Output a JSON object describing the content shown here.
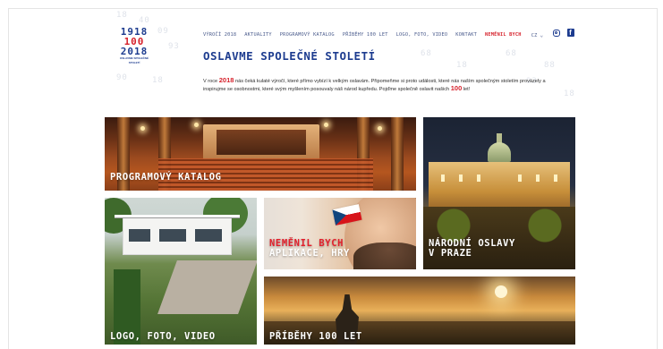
{
  "logo": {
    "years": [
      "1918",
      "100",
      "2018"
    ],
    "subtitle": "OSLAVME SPOLEČNÉ STOLETÍ"
  },
  "nav": {
    "items": [
      {
        "label": "Výročí 2018",
        "active": false
      },
      {
        "label": "Aktuality",
        "active": false
      },
      {
        "label": "Programový katalog",
        "active": false
      },
      {
        "label": "Příběhy 100 let",
        "active": false
      },
      {
        "label": "Logo, foto, video",
        "active": false
      },
      {
        "label": "Kontakt",
        "active": false
      },
      {
        "label": "Neměnil bych",
        "active": true
      }
    ],
    "language": "CZ",
    "social": [
      "instagram-icon",
      "facebook-icon"
    ]
  },
  "hero": {
    "title": "OSLAVME SPOLEČNÉ STOLETÍ",
    "intro_part1": "V roce ",
    "intro_year": "2018",
    "intro_part2": " nás čeká kulaté výročí, které přímo vybízí k velkým oslavám. Připomeňme si proto události, které nás naším společným stoletím provázely a inspirujme se osobnostmi, které svým myšlením posouvaly náš národ kupředu. Pojďme společně oslavit našich ",
    "intro_hundred": "100",
    "intro_part3": " let!"
  },
  "tiles": {
    "catalog": "PROGRAMOVÝ KATALOG",
    "national": [
      "NÁRODNÍ OSLAVY",
      "V PRAZE"
    ],
    "nemenil": [
      "NEMĚNIL BYCH",
      "APLIKACE, HRY"
    ],
    "logo": "LOGO, FOTO, VIDEO",
    "stories": "PŘÍBĚHY 100 LET"
  },
  "colors": {
    "blue": "#1d3c8f",
    "red": "#d6212b"
  }
}
